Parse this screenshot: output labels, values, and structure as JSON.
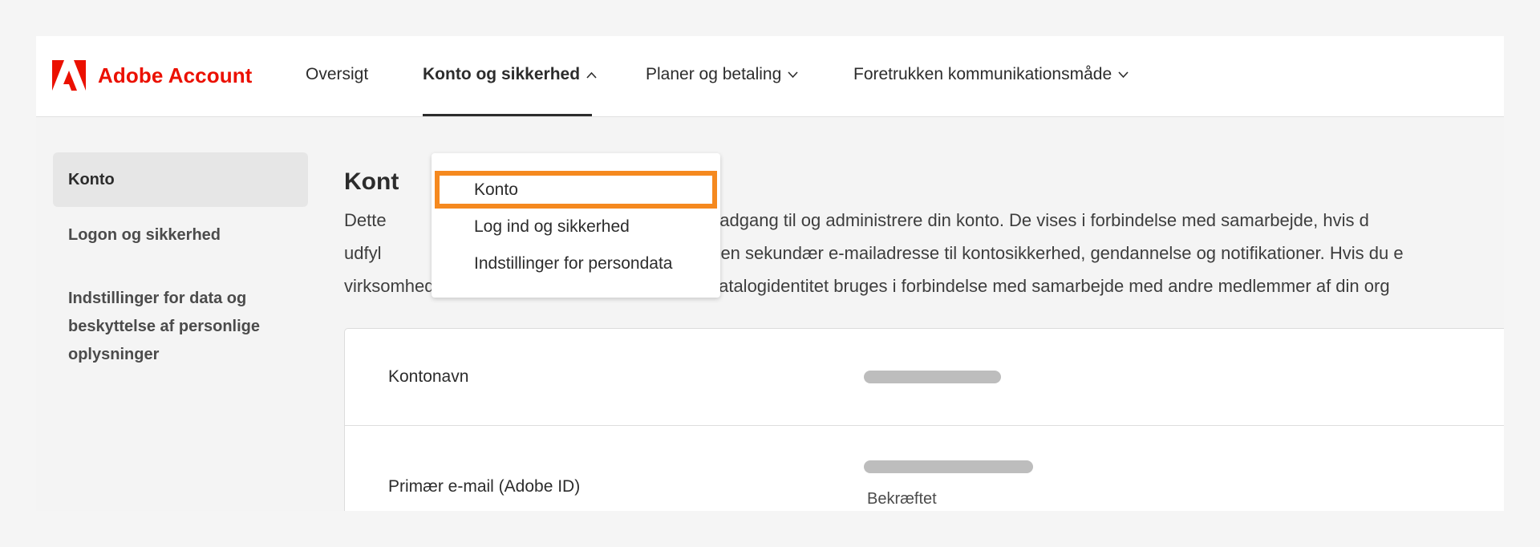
{
  "header": {
    "app_title": "Adobe Account",
    "nav": [
      {
        "label": "Oversigt",
        "has_chevron": false,
        "active": false
      },
      {
        "label": "Konto og sikkerhed",
        "has_chevron": true,
        "chevron": "up",
        "active": true
      },
      {
        "label": "Planer og betaling",
        "has_chevron": true,
        "chevron": "down",
        "active": false
      },
      {
        "label": "Foretrukken kommunikationsmåde",
        "has_chevron": true,
        "chevron": "down",
        "active": false
      }
    ],
    "brand_color": "#eb1000"
  },
  "dropdown": {
    "items": [
      {
        "label": "Konto",
        "highlighted": true
      },
      {
        "label": "Log ind og sikkerhed",
        "highlighted": false
      },
      {
        "label": "Indstillinger for persondata",
        "highlighted": false
      }
    ],
    "highlight_color": "#f5891f"
  },
  "sidebar": {
    "items": [
      {
        "label": "Konto",
        "selected": true
      },
      {
        "label": "Logon og sikkerhed",
        "selected": false
      },
      {
        "label_lines": [
          "Indstillinger for data og",
          "beskyttelse af personlige",
          "oplysninger"
        ],
        "selected": false
      }
    ]
  },
  "main": {
    "title": "Kont",
    "description_lines": [
      "Dette                                             bruger til at få adgang til og administrere din konto. De vises i forbindelse med samarbejde, hvis d",
      "udfyl                                                      mmer og en sekundær e-mailadresse til kontosikkerhed, gendannelse og notifikationer. Hvis du e",
      "virksomhedsorganisation, kan din virksomhedskatalogidentitet bruges i forbindelse med samarbejde med andre medlemmer af din org"
    ],
    "fields": [
      {
        "label": "Kontonavn",
        "value_redacted": true
      },
      {
        "label": "Primær e-mail (Adobe ID)",
        "value_redacted": true,
        "status": "Bekræftet"
      }
    ]
  }
}
